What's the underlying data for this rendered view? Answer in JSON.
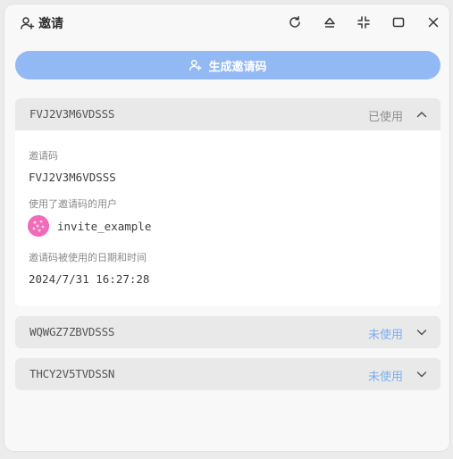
{
  "window": {
    "title": "邀请"
  },
  "actions": {
    "generate_label": "生成邀请码"
  },
  "invites": [
    {
      "code": "FVJ2V3M6VDSSS",
      "status": "已使用",
      "status_color": "#8f8f8f",
      "expanded": true,
      "details": {
        "code_label": "邀请码",
        "code_value": "FVJ2V3M6VDSSS",
        "user_label": "使用了邀请码的用户",
        "user_name": "invite_example",
        "time_label": "邀请码被使用的日期和时间",
        "time_value": "2024/7/31 16:27:28"
      }
    },
    {
      "code": "WQWGZ7ZBVDSSS",
      "status": "未使用",
      "status_color": "#7aaef0",
      "expanded": false
    },
    {
      "code": "THCY2V5TVDSSN",
      "status": "未使用",
      "status_color": "#7aaef0",
      "expanded": false
    }
  ],
  "colors": {
    "accent": "#93b9f5",
    "used": "#8f8f8f",
    "unused": "#7aaef0"
  }
}
